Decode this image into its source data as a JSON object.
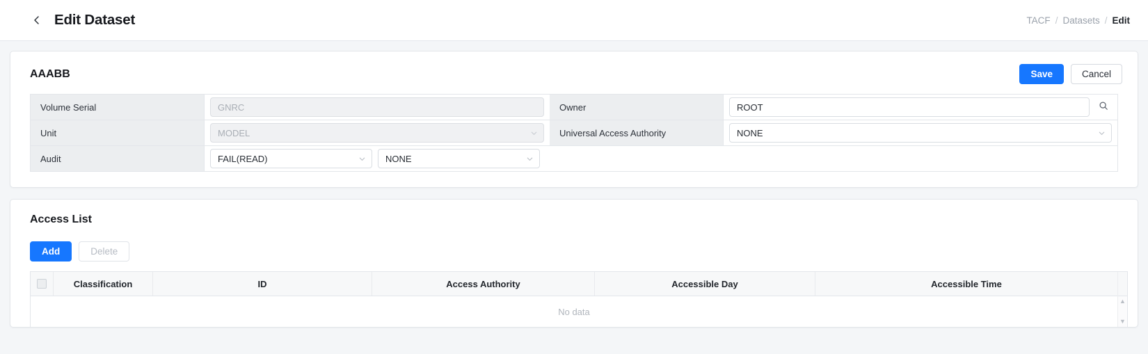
{
  "header": {
    "back_icon": "chevron-left-icon",
    "title": "Edit Dataset",
    "breadcrumb": [
      {
        "label": "TACF",
        "active": false
      },
      {
        "label": "Datasets",
        "active": false
      },
      {
        "label": "Edit",
        "active": true
      }
    ],
    "breadcrumb_separator": "/"
  },
  "details": {
    "title": "AAABB",
    "save_label": "Save",
    "cancel_label": "Cancel",
    "fields": {
      "volume_serial_label": "Volume Serial",
      "volume_serial_value": "GNRC",
      "unit_label": "Unit",
      "unit_value": "MODEL",
      "audit_label": "Audit",
      "audit_value_1": "FAIL(READ)",
      "audit_value_2": "NONE",
      "owner_label": "Owner",
      "owner_value": "ROOT",
      "owner_search_icon": "search-icon",
      "uaa_label": "Universal Access Authority",
      "uaa_value": "NONE"
    }
  },
  "access_list": {
    "title": "Access List",
    "add_label": "Add",
    "delete_label": "Delete",
    "columns": [
      "Classification",
      "ID",
      "Access Authority",
      "Accessible Day",
      "Accessible Time"
    ],
    "empty_text": "No data",
    "scroll_up_icon": "caret-up-icon",
    "scroll_down_icon": "caret-down-icon"
  },
  "colors": {
    "primary": "#1677ff",
    "label_bg": "#eceef0",
    "page_bg": "#f4f6f8",
    "border": "#e3e6ea",
    "muted_text": "#9aa1ab"
  }
}
